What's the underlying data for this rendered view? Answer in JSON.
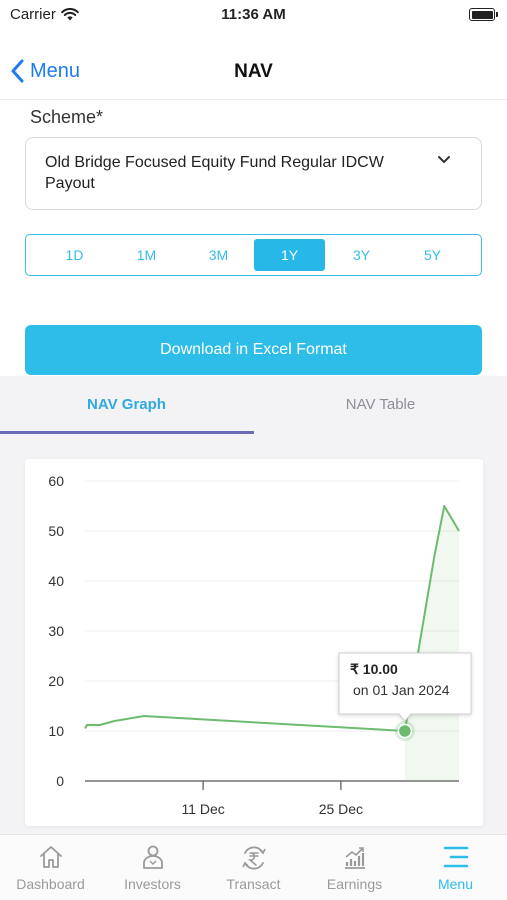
{
  "status": {
    "carrier": "Carrier",
    "time": "11:36 AM"
  },
  "nav": {
    "back_label": "Menu",
    "title": "NAV"
  },
  "scheme": {
    "label": "Scheme*",
    "value": "Old Bridge Focused Equity Fund Regular IDCW Payout"
  },
  "periods": [
    "1D",
    "1M",
    "3M",
    "1Y",
    "3Y",
    "5Y"
  ],
  "active_period": "1Y",
  "download_label": "Download in Excel Format",
  "tabs": {
    "graph": "NAV Graph",
    "table": "NAV Table",
    "active": "graph"
  },
  "chart_data": {
    "type": "line",
    "title": "",
    "xlabel": "",
    "ylabel": "",
    "ylim": [
      0,
      60
    ],
    "yticks": [
      0,
      10,
      20,
      30,
      40,
      50,
      60
    ],
    "xticks": [
      {
        "label": "11 Dec",
        "day": 11
      },
      {
        "label": "25 Dec",
        "day": 25
      }
    ],
    "xlim_days": [
      -1,
      37
    ],
    "grid": true,
    "series": [
      {
        "color": "#6dbb6f",
        "points": [
          {
            "day": -1,
            "value": 10.5
          },
          {
            "day": -0.8,
            "value": 11.2
          },
          {
            "day": 0.5,
            "value": 11.2
          },
          {
            "day": 2,
            "value": 12.0
          },
          {
            "day": 5,
            "value": 13.0
          },
          {
            "day": 31.5,
            "value": 10.0
          },
          {
            "day": 34.5,
            "value": 45.0
          },
          {
            "day": 35.5,
            "value": 55.0
          },
          {
            "day": 37,
            "value": 50.0
          }
        ]
      }
    ],
    "tooltip": {
      "price": "₹ 10.00",
      "date": "on 01 Jan 2024",
      "day": 31.5,
      "value": 10.0
    }
  },
  "bottom_tabs": [
    {
      "label": "Dashboard",
      "icon": "home-icon"
    },
    {
      "label": "Investors",
      "icon": "investors-icon"
    },
    {
      "label": "Transact",
      "icon": "rupee-transact-icon"
    },
    {
      "label": "Earnings",
      "icon": "earnings-chart-icon"
    },
    {
      "label": "Menu",
      "icon": "menu-icon"
    }
  ],
  "active_bottom_tab": "Menu",
  "colors": {
    "accent": "#2dbde8",
    "back_blue": "#1e7cf0",
    "line_green": "#6dbb6f",
    "tab_underline": "#6c6bb8"
  }
}
